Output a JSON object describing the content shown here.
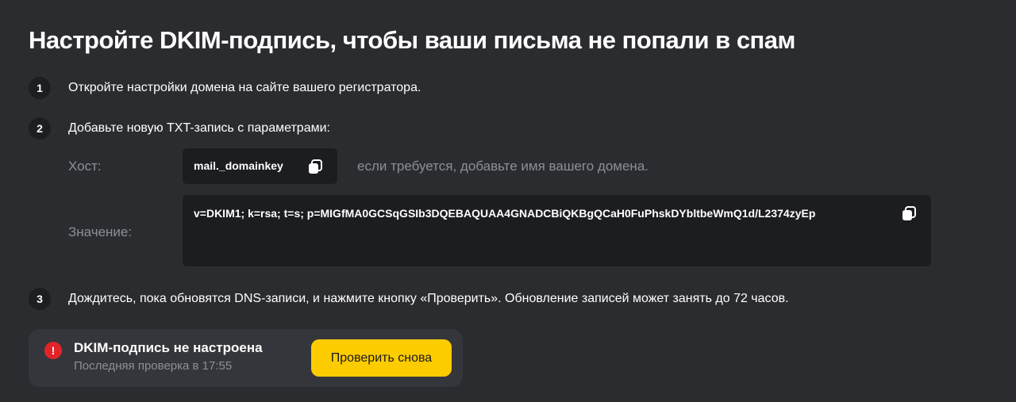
{
  "title": "Настройте DKIM-подпись, чтобы ваши письма не попали в спам",
  "steps": [
    {
      "num": "1",
      "text": "Откройте настройки домена на сайте вашего регистратора."
    },
    {
      "num": "2",
      "text": "Добавьте новую TXT-запись с параметрами:"
    },
    {
      "num": "3",
      "text": "Дождитесь, пока обновятся DNS-записи, и нажмите кнопку «Проверить». Обновление записей может занять до 72 часов."
    }
  ],
  "record": {
    "host_label": "Хост:",
    "host_value": "mail._domainkey",
    "host_hint": "если требуется, добавьте имя вашего домена.",
    "value_label": "Значение:",
    "value_text": "v=DKIM1; k=rsa; t=s; p=MIGfMA0GCSqGSIb3DQEBAQUAA4GNADCBiQKBgQCaH0FuPhskDYbltbeWmQ1d/L2374zyEp",
    "copy_icon": "copy-icon"
  },
  "status": {
    "icon": "error-icon",
    "icon_glyph": "!",
    "title": "DKIM-подпись не настроена",
    "subtitle": "Последняя проверка в 17:55",
    "button_label": "Проверить снова"
  },
  "colors": {
    "background": "#2b2c30",
    "code_box": "#1c1d20",
    "card": "#35363b",
    "accent_button": "#fccc00",
    "error": "#e2242a",
    "muted_text": "#8d8f96"
  }
}
